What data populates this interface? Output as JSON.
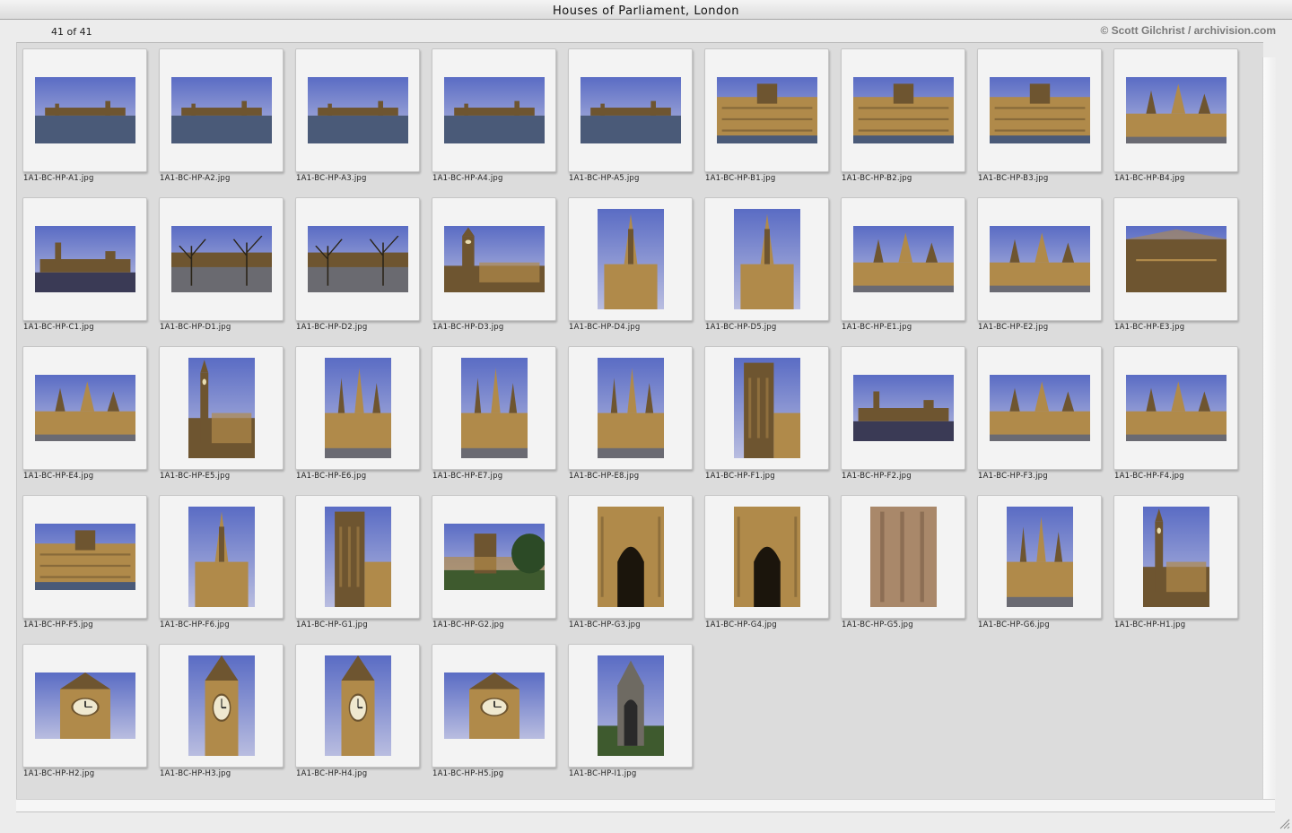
{
  "window": {
    "title": "Houses of Parliament, London"
  },
  "info": {
    "count": "41 of 41",
    "copyright": "© Scott Gilchrist / archivision.com"
  },
  "images": [
    {
      "name": "1A1-BC-HP-A1.jpg",
      "orient": "landscape",
      "scene": "wide"
    },
    {
      "name": "1A1-BC-HP-A2.jpg",
      "orient": "landscape",
      "scene": "wide"
    },
    {
      "name": "1A1-BC-HP-A3.jpg",
      "orient": "landscape",
      "scene": "wide"
    },
    {
      "name": "1A1-BC-HP-A4.jpg",
      "orient": "landscape",
      "scene": "wide"
    },
    {
      "name": "1A1-BC-HP-A5.jpg",
      "orient": "landscape",
      "scene": "wide"
    },
    {
      "name": "1A1-BC-HP-B1.jpg",
      "orient": "landscape",
      "scene": "facade"
    },
    {
      "name": "1A1-BC-HP-B2.jpg",
      "orient": "landscape",
      "scene": "facade"
    },
    {
      "name": "1A1-BC-HP-B3.jpg",
      "orient": "landscape",
      "scene": "facade"
    },
    {
      "name": "1A1-BC-HP-B4.jpg",
      "orient": "landscape",
      "scene": "spires"
    },
    {
      "name": "1A1-BC-HP-C1.jpg",
      "orient": "landscape",
      "scene": "street"
    },
    {
      "name": "1A1-BC-HP-D1.jpg",
      "orient": "landscape",
      "scene": "trees"
    },
    {
      "name": "1A1-BC-HP-D2.jpg",
      "orient": "landscape",
      "scene": "trees"
    },
    {
      "name": "1A1-BC-HP-D3.jpg",
      "orient": "landscape",
      "scene": "clocktower"
    },
    {
      "name": "1A1-BC-HP-D4.jpg",
      "orient": "portrait",
      "scene": "spire"
    },
    {
      "name": "1A1-BC-HP-D5.jpg",
      "orient": "portrait",
      "scene": "spire"
    },
    {
      "name": "1A1-BC-HP-E1.jpg",
      "orient": "landscape",
      "scene": "spires"
    },
    {
      "name": "1A1-BC-HP-E2.jpg",
      "orient": "landscape",
      "scene": "spires"
    },
    {
      "name": "1A1-BC-HP-E3.jpg",
      "orient": "landscape",
      "scene": "hall"
    },
    {
      "name": "1A1-BC-HP-E4.jpg",
      "orient": "landscape",
      "scene": "spires"
    },
    {
      "name": "1A1-BC-HP-E5.jpg",
      "orient": "portrait",
      "scene": "clocktower"
    },
    {
      "name": "1A1-BC-HP-E6.jpg",
      "orient": "portrait",
      "scene": "spires"
    },
    {
      "name": "1A1-BC-HP-E7.jpg",
      "orient": "portrait",
      "scene": "spires"
    },
    {
      "name": "1A1-BC-HP-E8.jpg",
      "orient": "portrait",
      "scene": "spires"
    },
    {
      "name": "1A1-BC-HP-F1.jpg",
      "orient": "portrait",
      "scene": "tower"
    },
    {
      "name": "1A1-BC-HP-F2.jpg",
      "orient": "landscape",
      "scene": "street"
    },
    {
      "name": "1A1-BC-HP-F3.jpg",
      "orient": "landscape",
      "scene": "spires"
    },
    {
      "name": "1A1-BC-HP-F4.jpg",
      "orient": "landscape",
      "scene": "spires"
    },
    {
      "name": "1A1-BC-HP-F5.jpg",
      "orient": "landscape",
      "scene": "facade"
    },
    {
      "name": "1A1-BC-HP-F6.jpg",
      "orient": "portrait",
      "scene": "spire"
    },
    {
      "name": "1A1-BC-HP-G1.jpg",
      "orient": "portrait",
      "scene": "tower"
    },
    {
      "name": "1A1-BC-HP-G2.jpg",
      "orient": "landscape",
      "scene": "park"
    },
    {
      "name": "1A1-BC-HP-G3.jpg",
      "orient": "portrait",
      "scene": "arch"
    },
    {
      "name": "1A1-BC-HP-G4.jpg",
      "orient": "portrait",
      "scene": "arch"
    },
    {
      "name": "1A1-BC-HP-G5.jpg",
      "orient": "portrait",
      "scene": "stone"
    },
    {
      "name": "1A1-BC-HP-G6.jpg",
      "orient": "portrait",
      "scene": "spires"
    },
    {
      "name": "1A1-BC-HP-H1.jpg",
      "orient": "portrait",
      "scene": "clocktower"
    },
    {
      "name": "1A1-BC-HP-H2.jpg",
      "orient": "landscape",
      "scene": "clockclose"
    },
    {
      "name": "1A1-BC-HP-H3.jpg",
      "orient": "portrait",
      "scene": "clockclose"
    },
    {
      "name": "1A1-BC-HP-H4.jpg",
      "orient": "portrait",
      "scene": "clockclose"
    },
    {
      "name": "1A1-BC-HP-H5.jpg",
      "orient": "landscape",
      "scene": "clockclose"
    },
    {
      "name": "1A1-BC-HP-I1.jpg",
      "orient": "portrait",
      "scene": "memorial"
    }
  ],
  "colors": {
    "sky_top": "#5a6cc4",
    "sky_bottom": "#b9bde0",
    "stone": "#b08a4a",
    "stone_dark": "#6e5530",
    "water": "#4a5a78",
    "grass": "#3e5a2e"
  }
}
